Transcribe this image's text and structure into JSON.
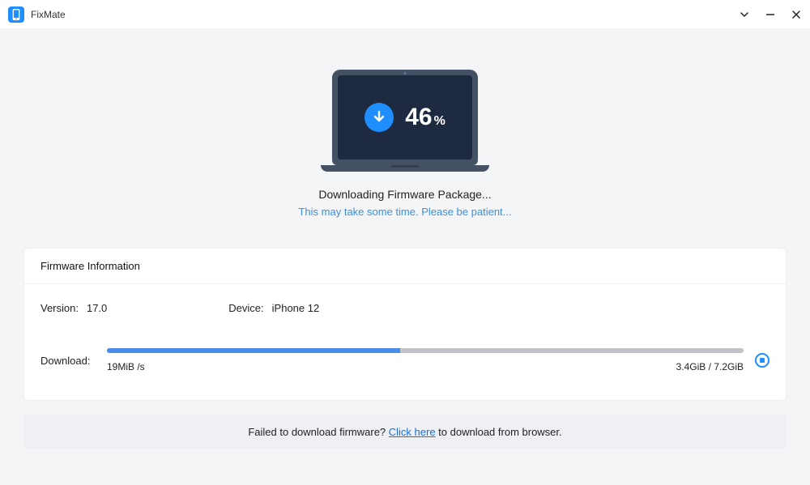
{
  "app": {
    "name": "FixMate"
  },
  "progress": {
    "percent": "46",
    "symbol": "%"
  },
  "status": {
    "title": "Downloading Firmware Package...",
    "subtitle": "This may take some time. Please be patient..."
  },
  "panel": {
    "heading": "Firmware Information",
    "version_label": "Version:",
    "version_value": "17.0",
    "device_label": "Device:",
    "device_value": "iPhone 12",
    "download_label": "Download:",
    "speed": "19MiB /s",
    "size": "3.4GiB / 7.2GiB",
    "progress_percent": 46
  },
  "footer": {
    "prefix": "Failed to download firmware? ",
    "link": "Click here",
    "suffix": " to download from browser."
  }
}
